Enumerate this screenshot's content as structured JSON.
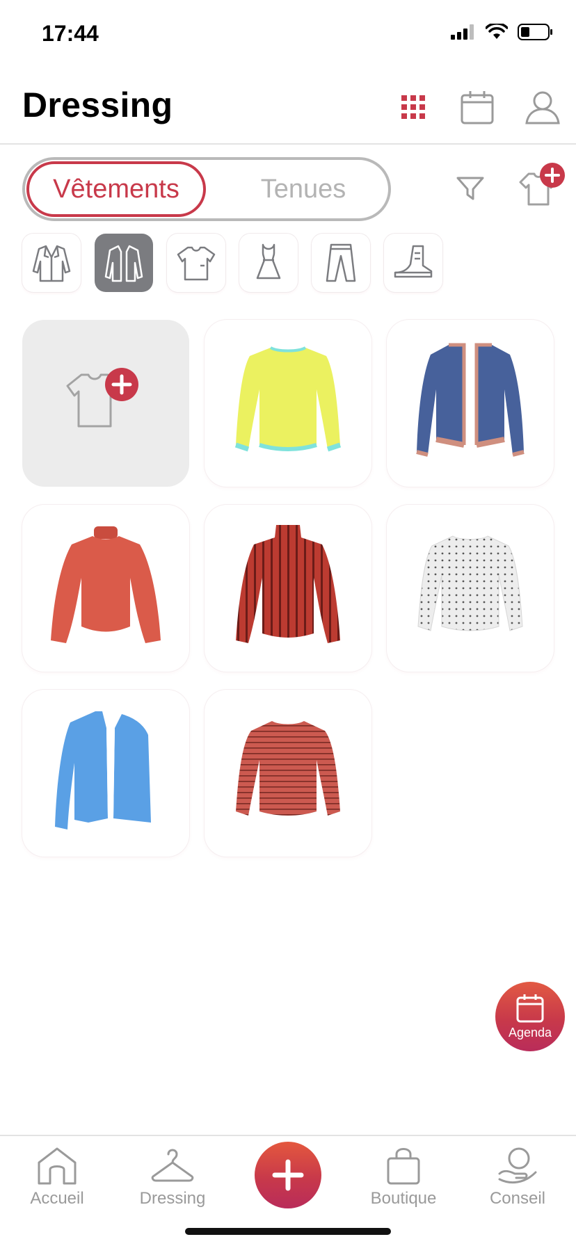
{
  "status_bar": {
    "time": "17:44"
  },
  "header": {
    "title": "Dressing",
    "icons": [
      "grid-icon",
      "calendar-icon",
      "profile-icon"
    ]
  },
  "segmented": {
    "active_label": "Vêtements",
    "inactive_label": "Tenues"
  },
  "toolbar": {
    "icons": [
      "filter-icon",
      "add-garment-icon"
    ]
  },
  "categories": [
    {
      "name": "blazer",
      "active": false
    },
    {
      "name": "cardigan",
      "active": true
    },
    {
      "name": "t-shirt",
      "active": false
    },
    {
      "name": "dress",
      "active": false
    },
    {
      "name": "pants",
      "active": false
    },
    {
      "name": "sneaker",
      "active": false
    }
  ],
  "garments": [
    {
      "name": "yellow-sweater",
      "color": "#eaf05e",
      "trim": "#7fe2dc",
      "type": "sweater"
    },
    {
      "name": "navy-cardigan",
      "color": "#45609a",
      "trim": "#d09080",
      "type": "cardigan"
    },
    {
      "name": "coral-turtleneck",
      "color": "#d8594a",
      "trim": "#c64a3c",
      "type": "turtleneck"
    },
    {
      "name": "striped-sequin-turtleneck",
      "color": "#b83a30",
      "trim": "#7a1f1a",
      "type": "turtleneck"
    },
    {
      "name": "white-dotted-sweater",
      "color": "#eeeeee",
      "trim": "#ffffff",
      "type": "sweater"
    },
    {
      "name": "blue-cardigan",
      "color": "#5a9fe4",
      "trim": "#ffffff",
      "type": "open"
    },
    {
      "name": "red-striped-sweater",
      "color": "#c8574e",
      "trim": "#a13c35",
      "type": "sweater"
    }
  ],
  "agenda_fab": {
    "label": "Agenda"
  },
  "bottom_nav": {
    "items": [
      {
        "label": "Accueil",
        "icon": "home-icon"
      },
      {
        "label": "Dressing",
        "icon": "hanger-icon"
      },
      {
        "label": "Boutique",
        "icon": "shopping-bag-icon"
      },
      {
        "label": "Conseil",
        "icon": "advice-icon"
      }
    ],
    "center_icon": "plus-icon"
  },
  "colors": {
    "accent": "#c8394a",
    "inactive": "#9a9a9a",
    "chip_active": "#7b7c80"
  }
}
